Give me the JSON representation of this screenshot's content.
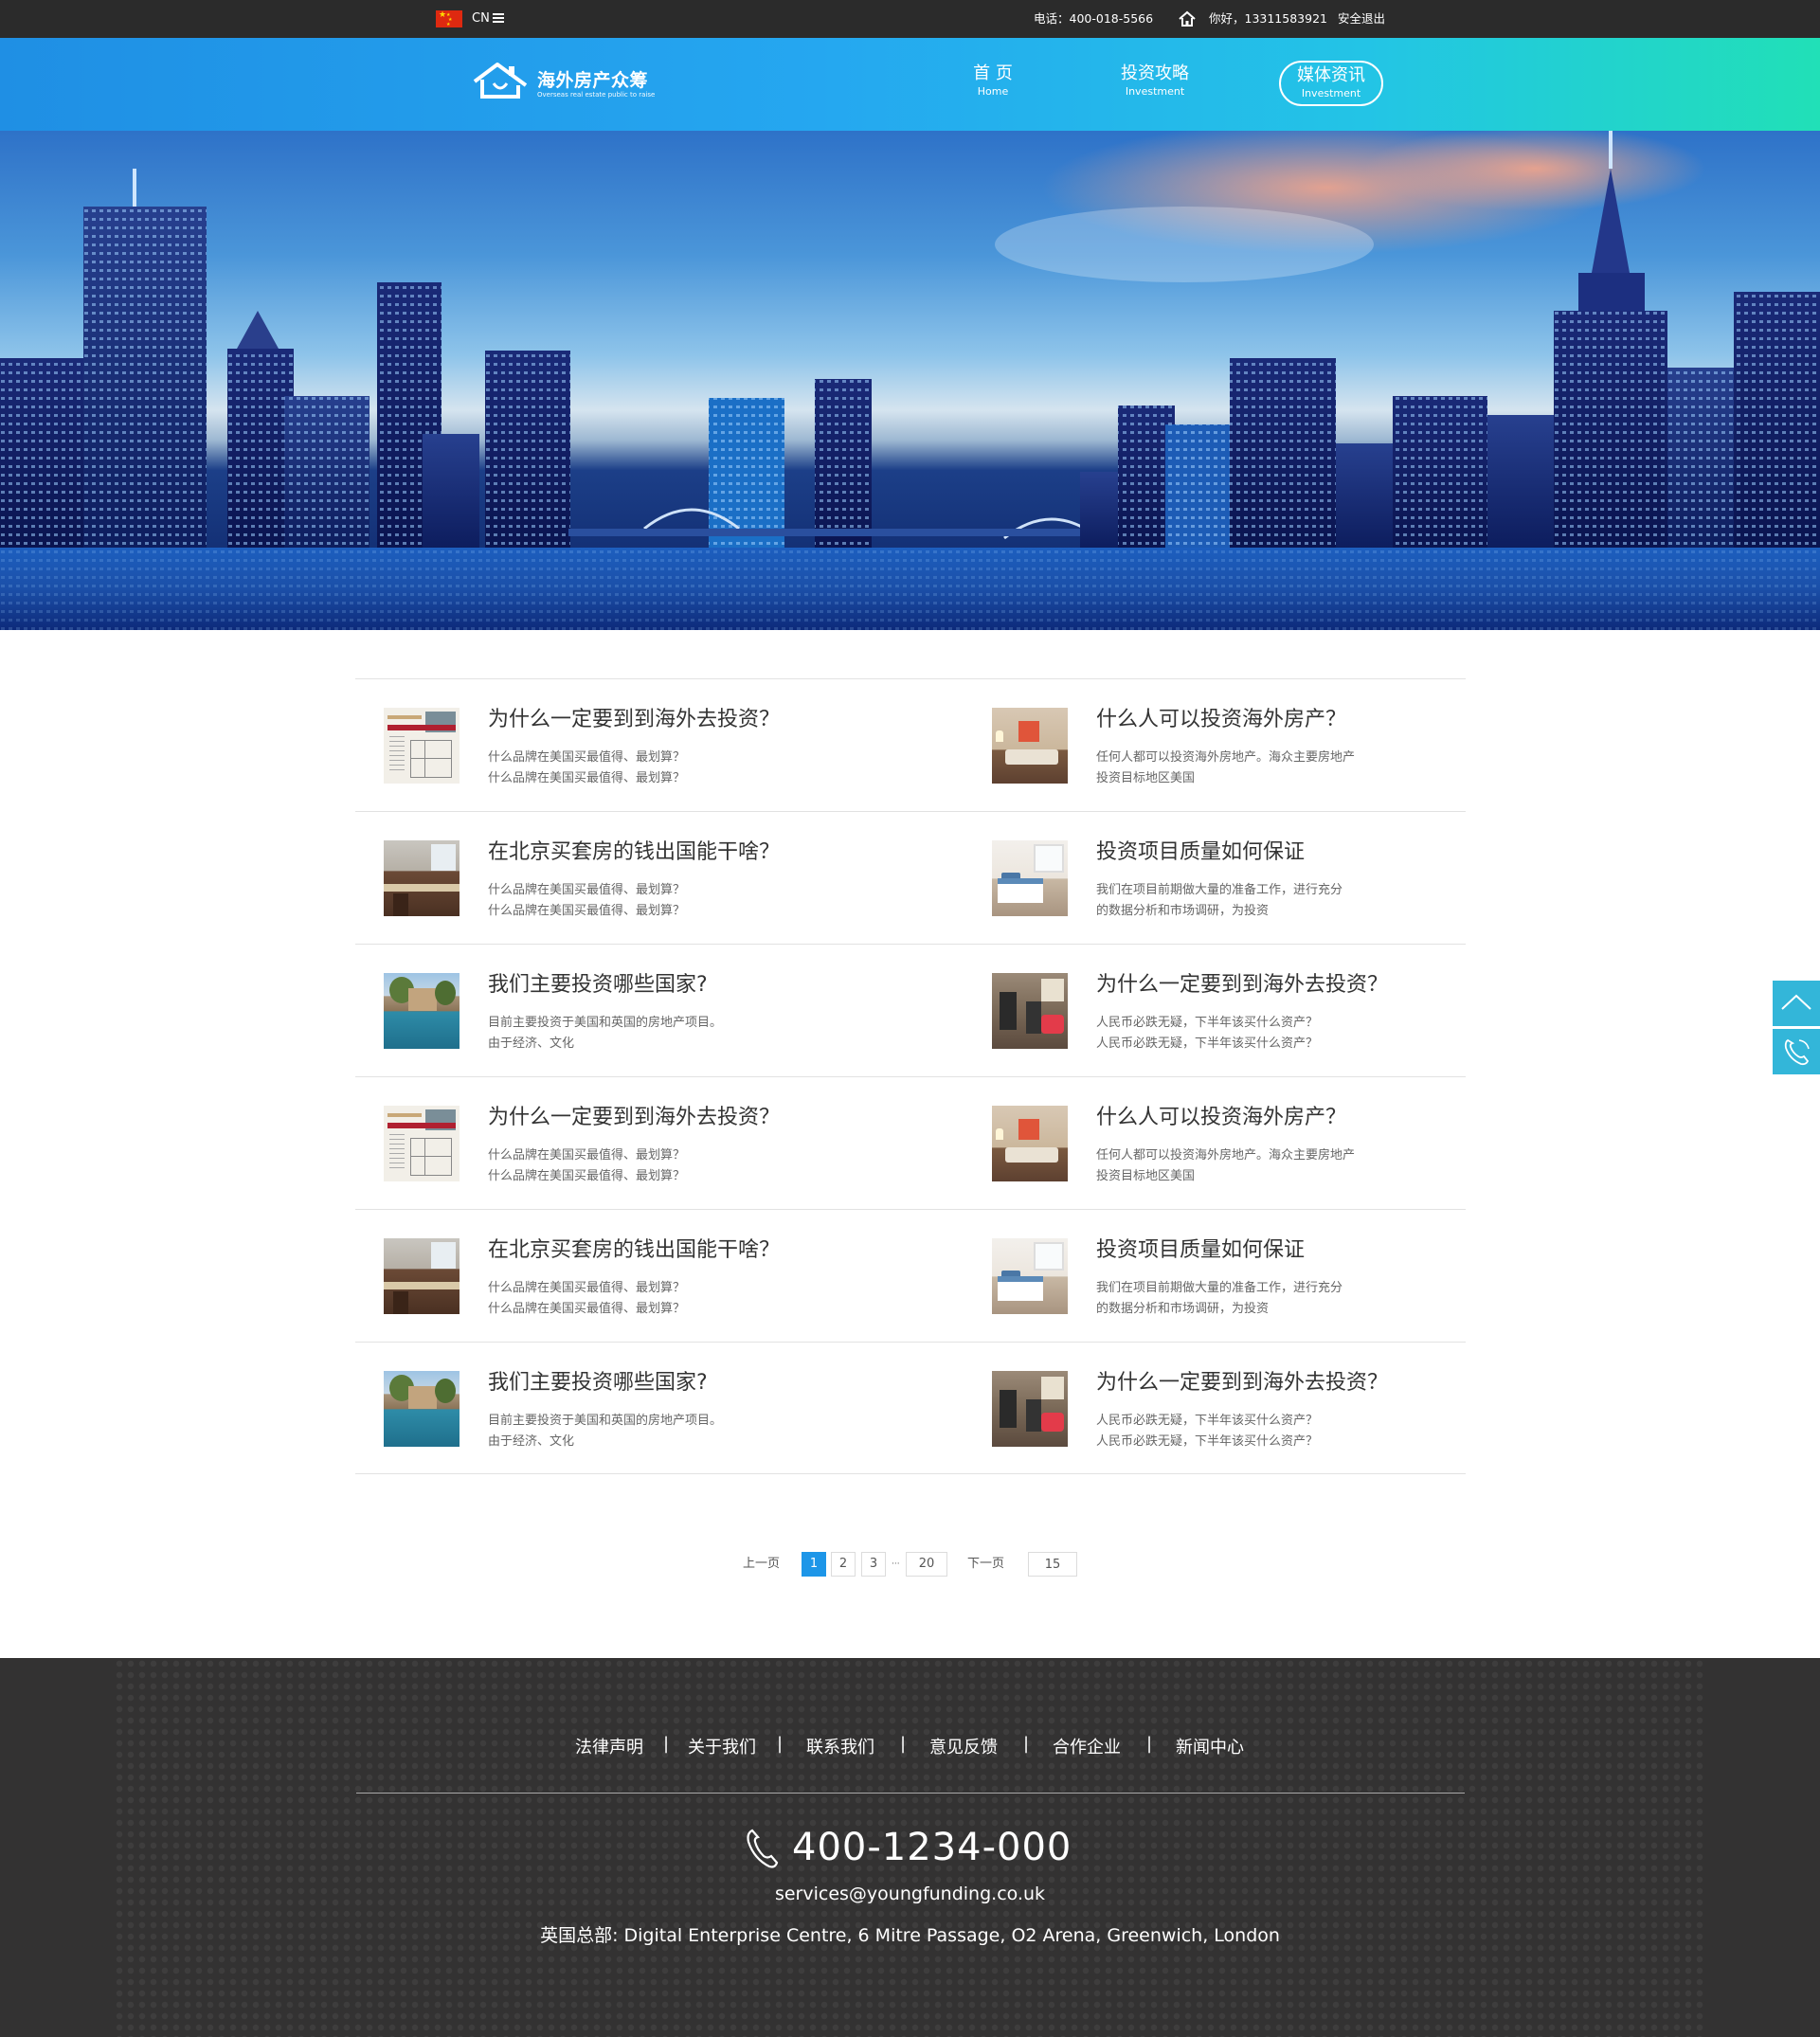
{
  "topbar": {
    "lang": "CN",
    "phone": "电话：400-018-5566",
    "greeting": "你好，13311583921",
    "logout": "安全退出"
  },
  "header": {
    "logo_title": "海外房产众筹",
    "logo_sub": "Overseas real estate public to raise",
    "nav": [
      {
        "cn": "首 页",
        "en": "Home"
      },
      {
        "cn": "投资攻略",
        "en": "Investment"
      },
      {
        "cn": "媒体资讯",
        "en": "Investment"
      }
    ]
  },
  "articles": [
    {
      "left": {
        "thumb": "floor-plan",
        "title": "为什么一定要到到海外去投资？",
        "desc": [
          "什么品牌在美国买最值得、最划算？",
          "什么品牌在美国买最值得、最划算？"
        ]
      },
      "right": {
        "thumb": "living-room",
        "title": "什么人可以投资海外房产？",
        "desc": [
          "任何人都可以投资海外房地产。海众主要房地产",
          "投资目标地区美国"
        ]
      }
    },
    {
      "left": {
        "thumb": "kitchen",
        "title": "在北京买套房的钱出国能干啥？",
        "desc": [
          "什么品牌在美国买最值得、最划算？",
          "什么品牌在美国买最值得、最划算？"
        ]
      },
      "right": {
        "thumb": "bedroom",
        "title": "投资项目质量如何保证",
        "desc": [
          "我们在项目前期做大量的准备工作，进行充分",
          "的数据分析和市场调研，为投资"
        ]
      }
    },
    {
      "left": {
        "thumb": "pool",
        "title": "我们主要投资哪些国家?",
        "desc": [
          "目前主要投资于美国和英国的房地产项目。",
          "由于经济、文化"
        ]
      },
      "right": {
        "thumb": "gym",
        "title": "为什么一定要到到海外去投资？",
        "desc": [
          "人民币必跌无疑，下半年该买什么资产？",
          "人民币必跌无疑，下半年该买什么资产？"
        ]
      }
    },
    {
      "left": {
        "thumb": "floor-plan",
        "title": "为什么一定要到到海外去投资？",
        "desc": [
          "什么品牌在美国买最值得、最划算？",
          "什么品牌在美国买最值得、最划算？"
        ]
      },
      "right": {
        "thumb": "living-room",
        "title": "什么人可以投资海外房产？",
        "desc": [
          "任何人都可以投资海外房地产。海众主要房地产",
          "投资目标地区美国"
        ]
      }
    },
    {
      "left": {
        "thumb": "kitchen",
        "title": "在北京买套房的钱出国能干啥？",
        "desc": [
          "什么品牌在美国买最值得、最划算？",
          "什么品牌在美国买最值得、最划算？"
        ]
      },
      "right": {
        "thumb": "bedroom",
        "title": "投资项目质量如何保证",
        "desc": [
          "我们在项目前期做大量的准备工作，进行充分",
          "的数据分析和市场调研，为投资"
        ]
      }
    },
    {
      "left": {
        "thumb": "pool",
        "title": "我们主要投资哪些国家?",
        "desc": [
          "目前主要投资于美国和英国的房地产项目。",
          "由于经济、文化"
        ]
      },
      "right": {
        "thumb": "gym",
        "title": "为什么一定要到到海外去投资？",
        "desc": [
          "人民币必跌无疑，下半年该买什么资产？",
          "人民币必跌无疑，下半年该买什么资产？"
        ]
      }
    }
  ],
  "pagination": {
    "prev": "上一页",
    "pages": [
      "1",
      "2",
      "3"
    ],
    "ellipsis": "···",
    "last": "20",
    "next": "下一页",
    "jump_value": "15",
    "current": 1
  },
  "footer": {
    "links": [
      "法律声明",
      "关于我们",
      "联系我们",
      "意见反馈",
      "合作企业",
      "新闻中心"
    ],
    "separator": "|",
    "phone": "400-1234-000",
    "email": "services@youngfunding.co.uk",
    "address": "英国总部: Digital Enterprise Centre, 6 Mitre Passage, O2 Arena, Greenwich, London"
  },
  "colors": {
    "topbar": "#2b2b2b",
    "nav_gradient_start": "#1f8fe4",
    "nav_gradient_end": "#21e0b7",
    "accent": "#1d96e8",
    "side_button": "#33b6d9",
    "footer": "#333232"
  },
  "icons": [
    "china-flag-icon",
    "menu-icon",
    "home-icon",
    "logo-house-icon",
    "scroll-top-icon",
    "phone-icon"
  ]
}
